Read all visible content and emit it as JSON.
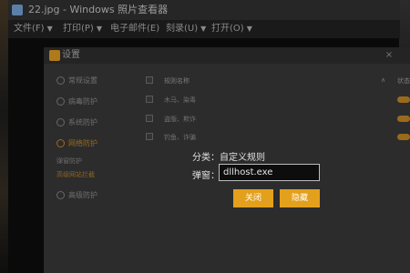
{
  "viewer": {
    "title": "22.jpg - Windows 照片查看器",
    "menu": [
      {
        "label": "文件(F)"
      },
      {
        "label": "打印(P)"
      },
      {
        "label": "电子邮件(E)"
      },
      {
        "label": "刻录(U)"
      },
      {
        "label": "打开(O)"
      }
    ]
  },
  "dialog": {
    "title": "设置",
    "close_glyph": "×",
    "sidebar": [
      {
        "label": "常规设置"
      },
      {
        "label": "病毒防护"
      },
      {
        "label": "系统防护"
      },
      {
        "label": "网络防护"
      },
      {
        "label": "高级防护"
      }
    ],
    "sub_items": [
      {
        "label": "弹窗防护"
      },
      {
        "label": "高级网站拦截"
      }
    ],
    "table": {
      "columns": [
        "规则名称",
        "状态"
      ],
      "rows": [
        {
          "name": "木马、染毒"
        },
        {
          "name": "盗版、欺诈"
        },
        {
          "name": "钓鱼、诈骗"
        }
      ]
    }
  },
  "popup": {
    "category_line": "分类：自定义规则",
    "field_label": "弹窗：",
    "field_value": "dllhost.exe",
    "close_button": "关闭",
    "hide_button": "隐藏"
  },
  "colors": {
    "accent": "#e3a01c",
    "background": "#2c2c2c"
  }
}
